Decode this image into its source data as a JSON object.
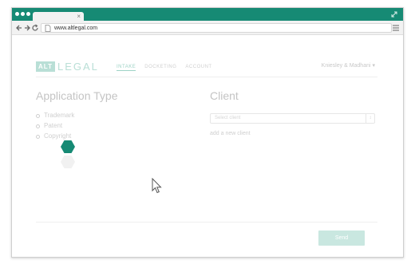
{
  "browser": {
    "tab_close": "×",
    "url": "www.altlegal.com"
  },
  "app": {
    "logo_box": "ALT",
    "logo_word": "LEGAL",
    "nav": [
      {
        "label": "INTAKE",
        "active": true
      },
      {
        "label": "DOCKETING",
        "active": false
      },
      {
        "label": "ACCOUNT",
        "active": false
      }
    ],
    "firm": "Kniesley & Madhani ▾"
  },
  "application_type": {
    "heading": "Application Type",
    "options": [
      "Trademark",
      "Patent",
      "Copyright"
    ]
  },
  "client": {
    "heading": "Client",
    "select_placeholder": "Select client",
    "select_arrow": "↕",
    "add_link": "add a new client"
  },
  "actions": {
    "send_label": "Send"
  },
  "colors": {
    "titlebar": "#168a74",
    "accent": "#b9dfd6",
    "loader_hex": "#168a74"
  }
}
